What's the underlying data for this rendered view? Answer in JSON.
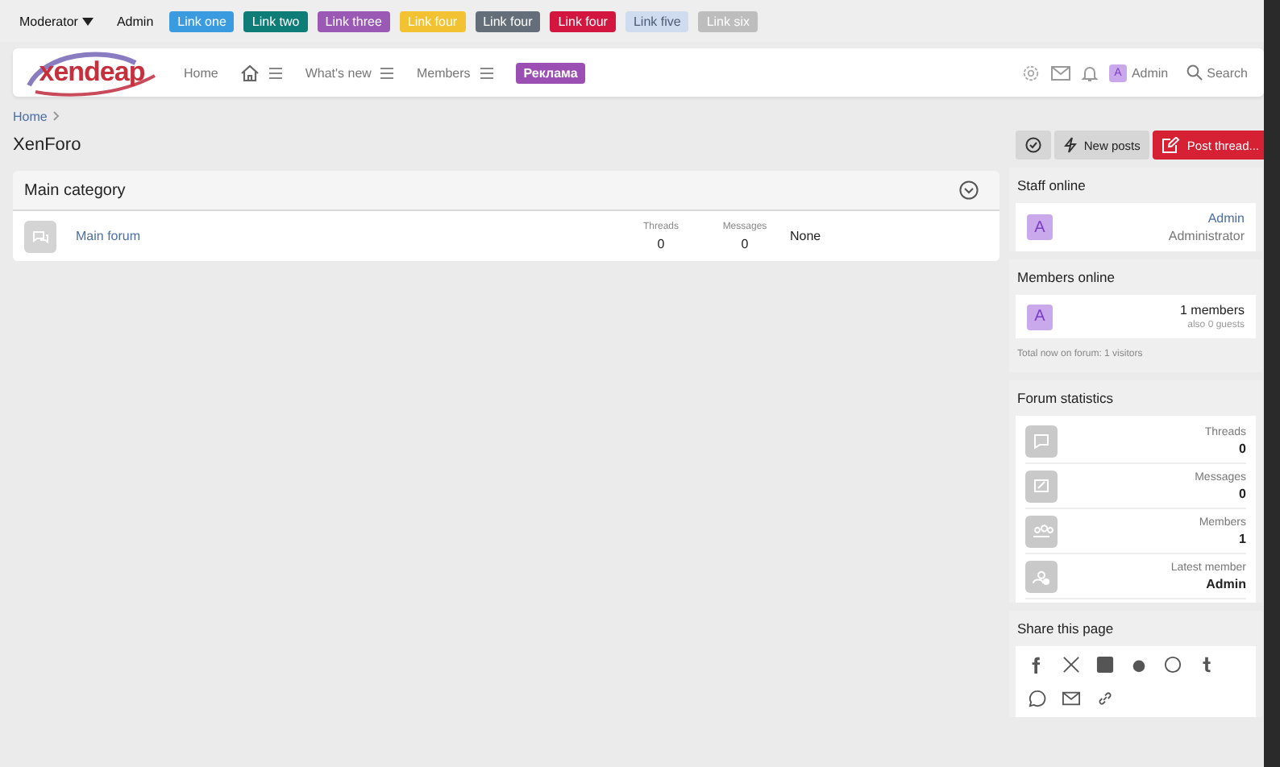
{
  "top_bar": {
    "user_menu": "Moderator",
    "admin": "Admin",
    "links": [
      {
        "label": "Link one",
        "color": "#3a9be0"
      },
      {
        "label": "Link two",
        "color": "#0e7c77"
      },
      {
        "label": "Link three",
        "color": "#9b59b6"
      },
      {
        "label": "Link four",
        "color": "#f2c232"
      },
      {
        "label": "Link four",
        "color": "#636e78"
      },
      {
        "label": "Link four",
        "color": "#d3163f"
      },
      {
        "label": "Link five",
        "color": "#cfdcef"
      },
      {
        "label": "Link six",
        "color": "#bdbdbd"
      }
    ]
  },
  "header": {
    "logo": "xendeap",
    "nav": [
      {
        "label": "Home",
        "kind": "link"
      },
      {
        "kind": "home"
      },
      {
        "label": "What's new",
        "kind": "menu"
      },
      {
        "label": "Members",
        "kind": "menu"
      },
      {
        "label": "Реклама",
        "kind": "badge"
      }
    ],
    "user": {
      "avatar": "A",
      "name": "Admin"
    },
    "search": "Search"
  },
  "breadcrumb": [
    "Home"
  ],
  "page_title": "XenForo",
  "actions": [
    {
      "kind": "icon"
    },
    {
      "label": "New posts",
      "kind": "secondary"
    },
    {
      "label": "Post thread...",
      "kind": "primary"
    }
  ],
  "category": {
    "title": "Main category",
    "forums": [
      {
        "name": "Main forum",
        "threads_label": "Threads",
        "threads": "0",
        "messages_label": "Messages",
        "messages": "0",
        "latest": "None"
      }
    ]
  },
  "sidebar": {
    "staff_online": {
      "title": "Staff online",
      "members": [
        {
          "avatar": "A",
          "name": "Admin",
          "role": "Administrator"
        }
      ]
    },
    "members_online": {
      "title": "Members online",
      "avatar": "A",
      "count": "1 members",
      "guests": "also 0 guests",
      "total": "Total now on forum: 1 visitors"
    },
    "forum_statistics": {
      "title": "Forum statistics",
      "rows": [
        {
          "label": "Threads",
          "value": "0",
          "kind": "threads"
        },
        {
          "label": "Messages",
          "value": "0",
          "kind": "messages"
        },
        {
          "label": "Members",
          "value": "1",
          "kind": "members"
        },
        {
          "label": "Latest member",
          "value": "Admin",
          "kind": "latest"
        }
      ]
    },
    "share": {
      "title": "Share this page"
    }
  }
}
